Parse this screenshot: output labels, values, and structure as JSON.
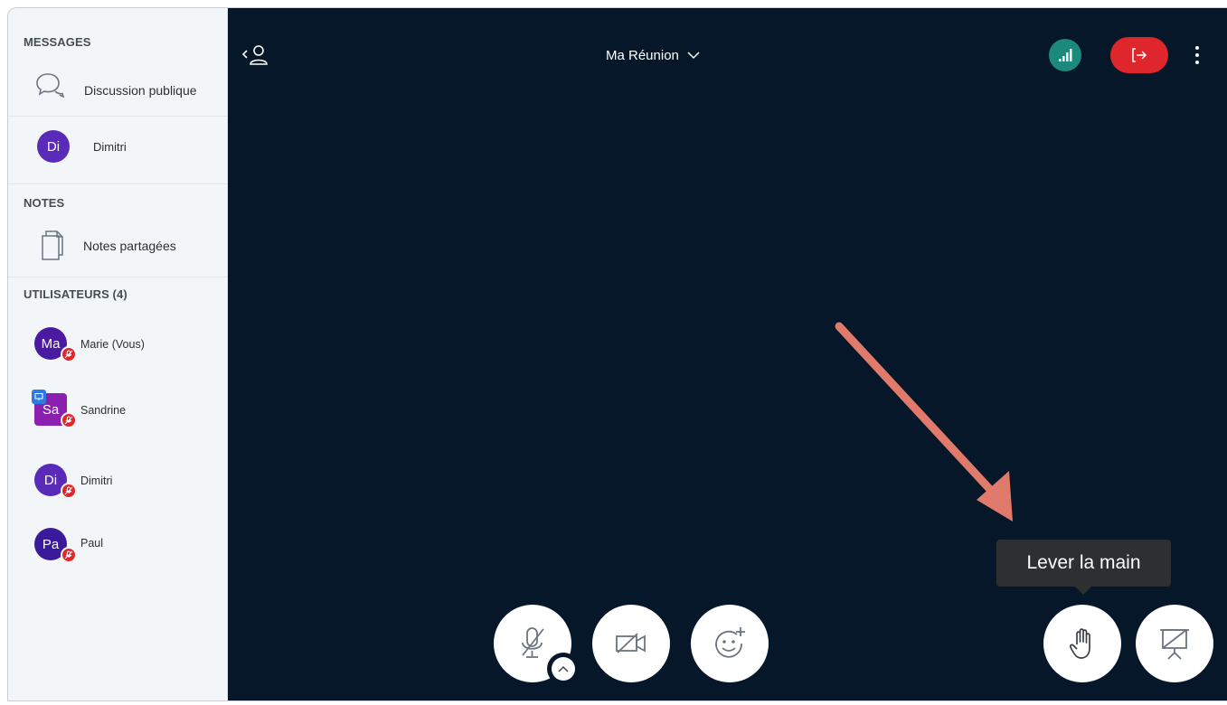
{
  "sidebar": {
    "messages_header": "MESSAGES",
    "public_chat_label": "Discussion publique",
    "private_chat": {
      "initials": "Di",
      "name": "Dimitri"
    },
    "notes_header": "NOTES",
    "shared_notes_label": "Notes partagées",
    "users_header": "UTILISATEURS (4)",
    "users": [
      {
        "initials": "Ma",
        "name": "Marie (Vous)",
        "color": "#4a1aa0"
      },
      {
        "initials": "Sa",
        "name": "Sandrine",
        "color": "#8a1fb0"
      },
      {
        "initials": "Di",
        "name": "Dimitri",
        "color": "#5a2ab8"
      },
      {
        "initials": "Pa",
        "name": "Paul",
        "color": "#3a1a9a"
      }
    ]
  },
  "header": {
    "meeting_title": "Ma Réunion"
  },
  "tooltip": {
    "text": "Lever la main"
  },
  "colors": {
    "background": "#06172a",
    "leave_button": "#e0262d",
    "connection": "#1b8a7c",
    "annotation_arrow": "#e07a6a"
  },
  "icons": {
    "toggle_userlist": "user-list-icon",
    "connection": "signal-icon",
    "leave": "leave-icon",
    "options": "more-vertical-icon",
    "mic": "microphone-muted-icon",
    "camera": "camera-off-icon",
    "reactions": "emoji-add-icon",
    "raise_hand": "hand-icon",
    "presentation": "presentation-icon"
  }
}
